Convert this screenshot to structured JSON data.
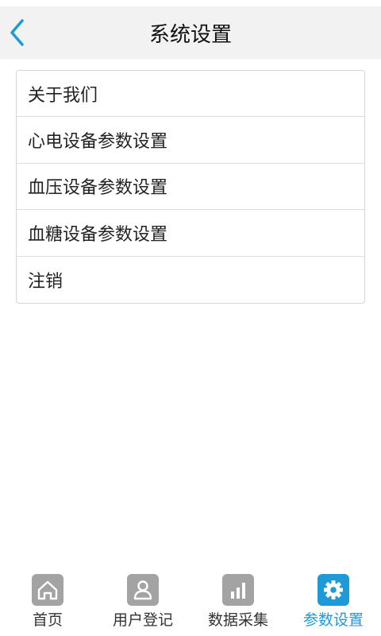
{
  "header": {
    "title": "系统设置",
    "back_icon": "chevron-left-icon"
  },
  "menu": {
    "items": [
      {
        "label": "关于我们"
      },
      {
        "label": "心电设备参数设置"
      },
      {
        "label": "血压设备参数设置"
      },
      {
        "label": "血糖设备参数设置"
      },
      {
        "label": "注销"
      }
    ]
  },
  "tabbar": {
    "tabs": [
      {
        "label": "首页",
        "icon": "home-icon",
        "active": false
      },
      {
        "label": "用户登记",
        "icon": "user-icon",
        "active": false
      },
      {
        "label": "数据采集",
        "icon": "bar-chart-icon",
        "active": false
      },
      {
        "label": "参数设置",
        "icon": "gear-icon",
        "active": true
      }
    ]
  },
  "colors": {
    "accent": "#1e9ad6",
    "icon_inactive": "#a3a3a3",
    "header_bg": "#f2f2f2"
  }
}
